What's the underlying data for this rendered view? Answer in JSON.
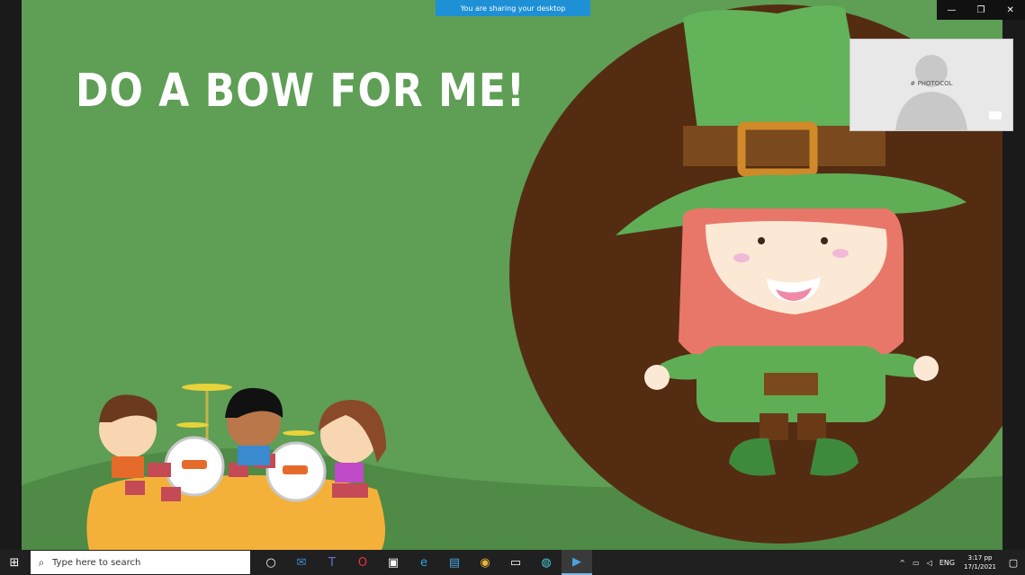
{
  "share_banner": "You are sharing your desktop",
  "window_controls": {
    "minimize": "—",
    "restore": "❐",
    "close": "✕"
  },
  "slide": {
    "headline": "DO A BOW FOR ME!"
  },
  "camera": {
    "label": "# PHOTOCOL",
    "icon": "video-camera-icon"
  },
  "taskbar": {
    "start_icon": "windows-logo-icon",
    "search_placeholder": "Type here to search",
    "apps": [
      "task-view",
      "mail",
      "teams",
      "opera",
      "store",
      "edge",
      "photos",
      "chrome",
      "camera",
      "app",
      "media"
    ],
    "tray_chevron": "^",
    "language": "ENG",
    "time": "3:17 pp",
    "date": "17/1/2021"
  }
}
